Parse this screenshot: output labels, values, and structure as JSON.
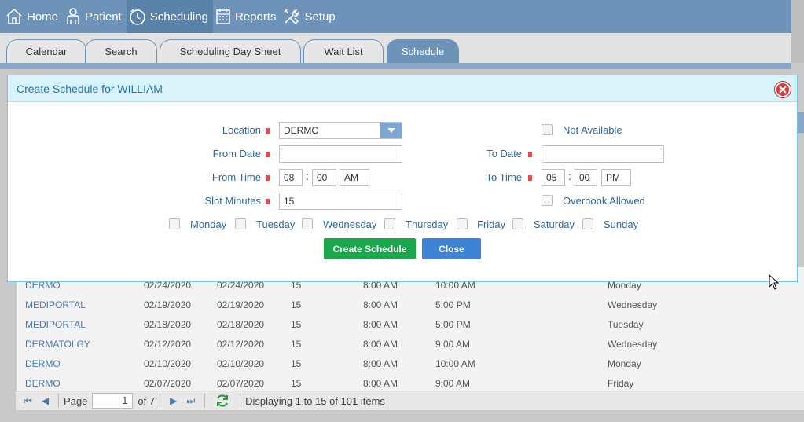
{
  "nav": {
    "items": [
      {
        "label": "Home",
        "icon": "home-icon"
      },
      {
        "label": "Patient",
        "icon": "patient-icon"
      },
      {
        "label": "Scheduling",
        "icon": "clock-icon"
      },
      {
        "label": "Reports",
        "icon": "calendar-icon"
      },
      {
        "label": "Setup",
        "icon": "tools-icon"
      }
    ],
    "active": "Scheduling"
  },
  "tabs": {
    "items": [
      "Calendar",
      "Search",
      "Scheduling Day Sheet",
      "Wait List",
      "Schedule"
    ],
    "active": "Schedule"
  },
  "dialog": {
    "title": "Create Schedule for WILLIAM",
    "location_label": "Location",
    "location_value": "DERMO",
    "from_date_label": "From Date",
    "from_date_value": "",
    "to_date_label": "To Date",
    "to_date_value": "",
    "from_time_label": "From Time",
    "from_time_hour": "08",
    "from_time_min": "00",
    "from_time_ampm": "AM",
    "to_time_label": "To Time",
    "to_time_hour": "05",
    "to_time_min": "00",
    "to_time_ampm": "PM",
    "time_separator": ":",
    "slot_minutes_label": "Slot Minutes",
    "slot_minutes_value": "15",
    "not_available_label": "Not Available",
    "overbook_label": "Overbook Allowed",
    "days": [
      "Monday",
      "Tuesday",
      "Wednesday",
      "Thursday",
      "Friday",
      "Saturday",
      "Sunday"
    ],
    "create_button": "Create Schedule",
    "close_button": "Close"
  },
  "grid": {
    "rows": [
      {
        "location": "DERMO",
        "from": "02/24/2020",
        "to": "02/24/2020",
        "slot": "15",
        "start": "8:00 AM",
        "end": "10:00 AM",
        "day": "Monday"
      },
      {
        "location": "MEDIPORTAL",
        "from": "02/19/2020",
        "to": "02/19/2020",
        "slot": "15",
        "start": "8:00 AM",
        "end": "5:00 PM",
        "day": "Wednesday"
      },
      {
        "location": "MEDIPORTAL",
        "from": "02/18/2020",
        "to": "02/18/2020",
        "slot": "15",
        "start": "8:00 AM",
        "end": "5:00 PM",
        "day": "Tuesday"
      },
      {
        "location": "DERMATOLGY",
        "from": "02/12/2020",
        "to": "02/12/2020",
        "slot": "15",
        "start": "8:00 AM",
        "end": "9:00 AM",
        "day": "Wednesday"
      },
      {
        "location": "DERMO",
        "from": "02/10/2020",
        "to": "02/10/2020",
        "slot": "15",
        "start": "8:00 AM",
        "end": "10:00 AM",
        "day": "Monday"
      },
      {
        "location": "DERMO",
        "from": "02/07/2020",
        "to": "02/07/2020",
        "slot": "15",
        "start": "8:00 AM",
        "end": "9:00 AM",
        "day": "Friday"
      }
    ]
  },
  "pager": {
    "page_label": "Page",
    "page_value": "1",
    "of_label": "of 7",
    "status": "Displaying 1 to 15 of 101 items"
  },
  "colors": {
    "nav_bg": "#6d93b8",
    "accent_blue": "#3e82d6",
    "create_green": "#1aa64a",
    "required_red": "#e84a4a",
    "label_blue": "#2a6aa3"
  }
}
